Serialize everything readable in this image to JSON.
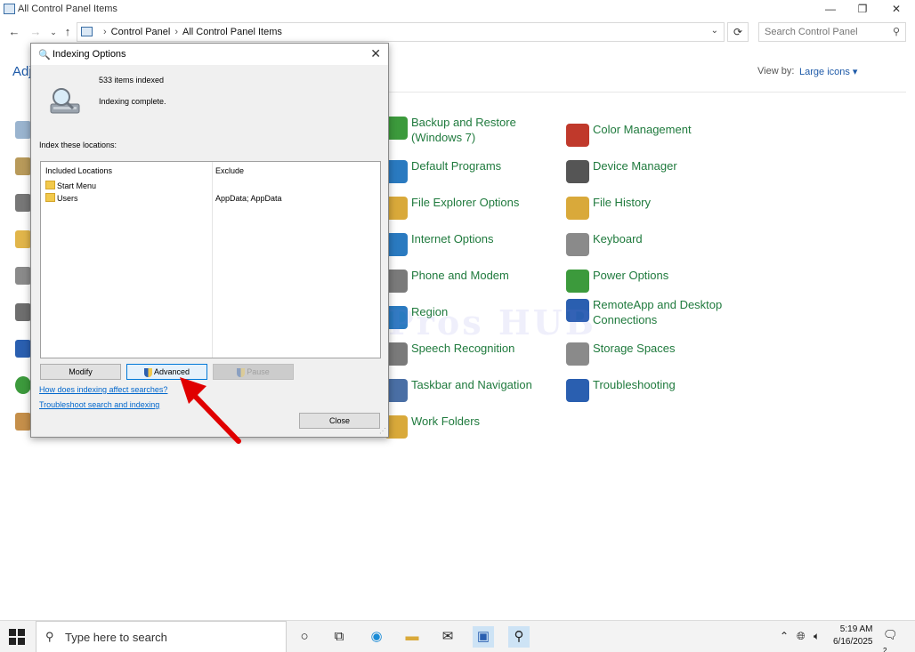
{
  "window": {
    "title": "All Control Panel Items",
    "controls": {
      "minimize": "—",
      "maximize": "❐",
      "close": "✕"
    }
  },
  "address": {
    "breadcrumbs": [
      "Control Panel",
      "All Control Panel Items"
    ],
    "search_placeholder": "Search Control Panel"
  },
  "page": {
    "heading_partial": "Adj",
    "view_by_label": "View by:",
    "view_by_value": "Large icons ▾"
  },
  "items_col1": [
    {
      "label": "Backup and Restore\n(Windows 7)",
      "icon": "backup-icon",
      "color": "#3c9a3c"
    },
    {
      "label": "Default Programs",
      "icon": "default-programs-icon",
      "color": "#2a7ac0"
    },
    {
      "label": "File Explorer Options",
      "icon": "folder-options-icon",
      "color": "#d9a93a"
    },
    {
      "label": "Internet Options",
      "icon": "internet-icon",
      "color": "#2a7ac0"
    },
    {
      "label": "Phone and Modem",
      "icon": "phone-icon",
      "color": "#7a7a7a"
    },
    {
      "label": "Region",
      "icon": "globe-icon",
      "color": "#2a7ac0"
    },
    {
      "label": "Speech Recognition",
      "icon": "microphone-icon",
      "color": "#7a7a7a"
    },
    {
      "label": "Taskbar and Navigation",
      "icon": "taskbar-icon",
      "color": "#4a6fa5"
    },
    {
      "label": "Work Folders",
      "icon": "work-folders-icon",
      "color": "#d9a93a"
    }
  ],
  "items_col2": [
    {
      "label": "Color Management",
      "icon": "color-management-icon",
      "color": "#c0392b"
    },
    {
      "label": "Device Manager",
      "icon": "device-manager-icon",
      "color": "#555555"
    },
    {
      "label": "File History",
      "icon": "file-history-icon",
      "color": "#d9a93a"
    },
    {
      "label": "Keyboard",
      "icon": "keyboard-icon",
      "color": "#8a8a8a"
    },
    {
      "label": "Power Options",
      "icon": "power-icon",
      "color": "#3c9a3c"
    },
    {
      "label": "RemoteApp and Desktop\nConnections",
      "icon": "remoteapp-icon",
      "color": "#2a5fb0"
    },
    {
      "label": "Storage Spaces",
      "icon": "storage-icon",
      "color": "#8a8a8a"
    },
    {
      "label": "Troubleshooting",
      "icon": "troubleshooting-icon",
      "color": "#2a5fb0"
    }
  ],
  "watermark": "IT Pros HUB",
  "dialog": {
    "title": "Indexing Options",
    "items_indexed": "533 items indexed",
    "status": "Indexing complete.",
    "locations_label": "Index these locations:",
    "columns": {
      "included": "Included Locations",
      "exclude": "Exclude"
    },
    "rows": [
      {
        "location": "Start Menu",
        "exclude": ""
      },
      {
        "location": "Users",
        "exclude": "AppData; AppData"
      }
    ],
    "buttons": {
      "modify": "Modify",
      "advanced": "Advanced",
      "pause": "Pause",
      "close": "Close"
    },
    "links": {
      "how": "How does indexing affect searches?",
      "troubleshoot": "Troubleshoot search and indexing"
    }
  },
  "taskbar": {
    "search_placeholder": "Type here to search",
    "time": "5:19 AM",
    "date": "6/16/2025",
    "notification_count": "2"
  }
}
